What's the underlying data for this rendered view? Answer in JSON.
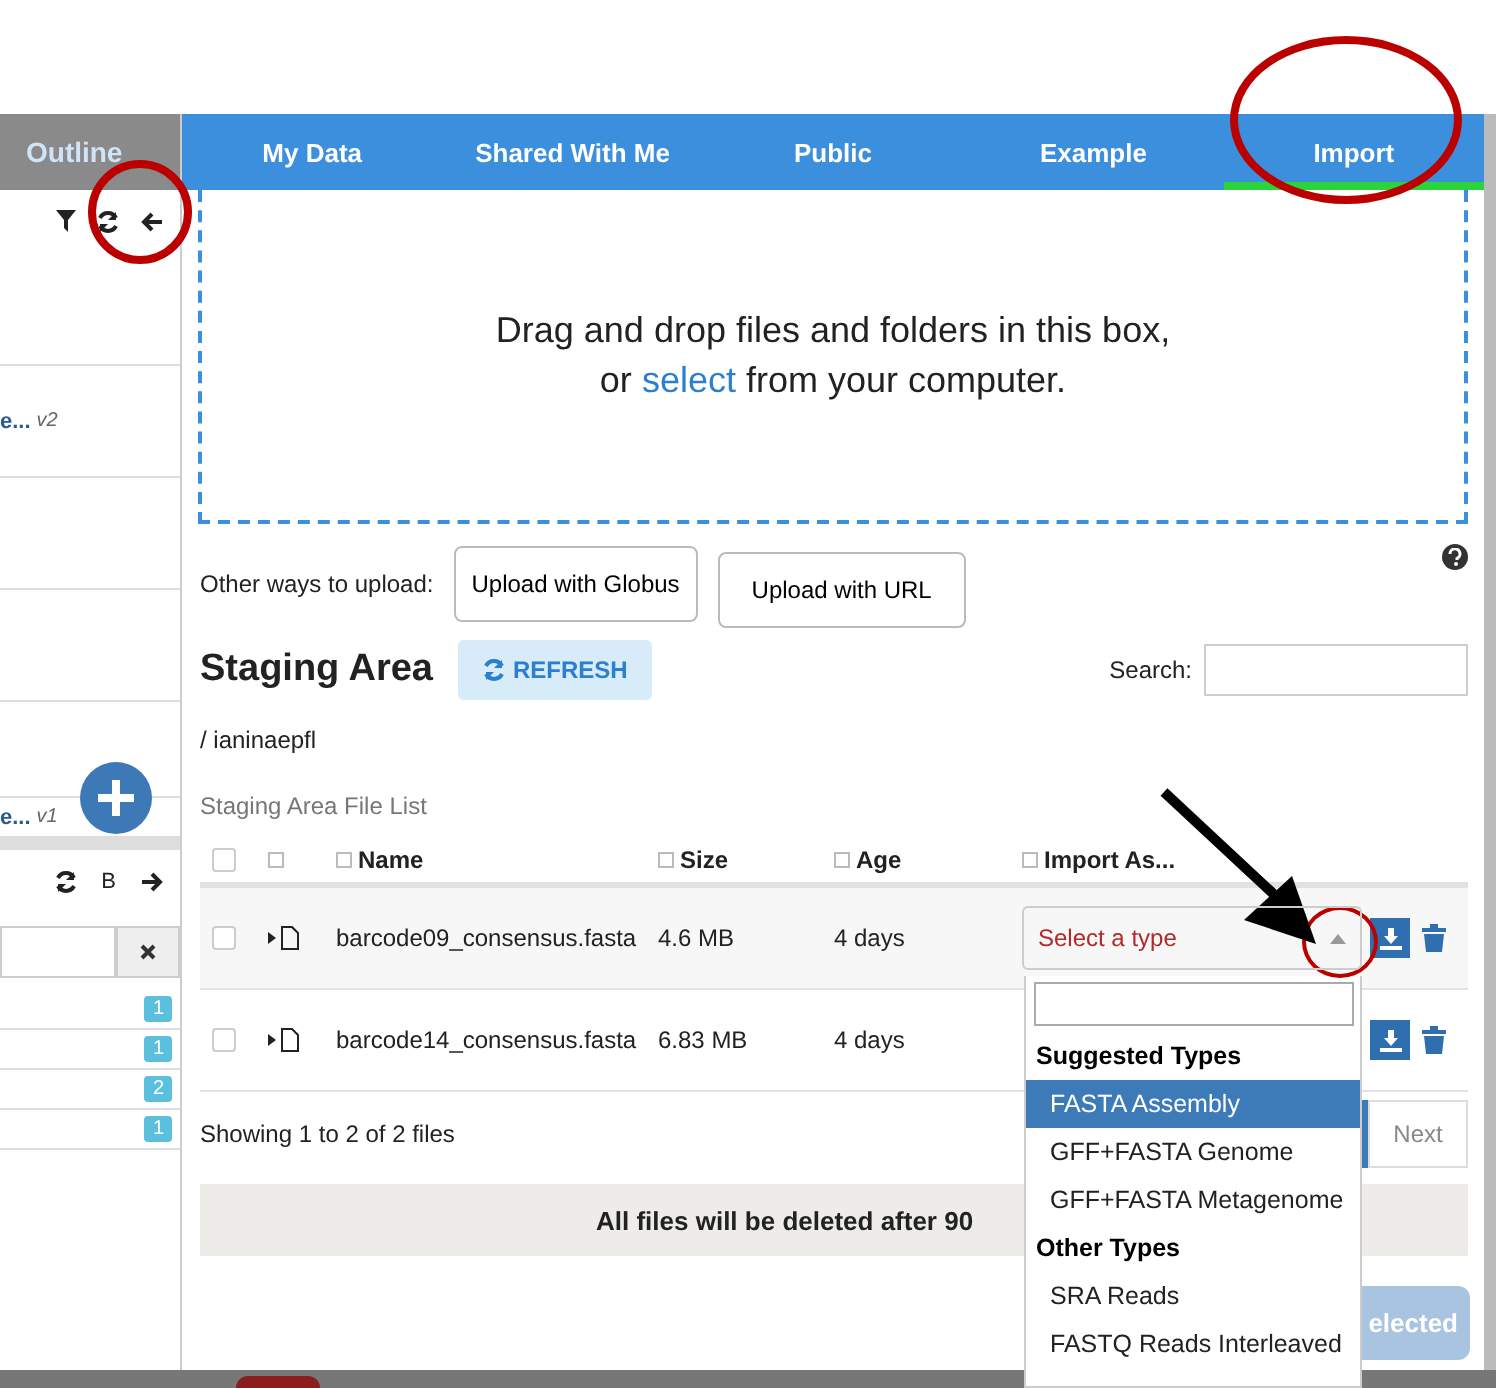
{
  "side_panel": {
    "title": "Outline",
    "items": [
      {
        "name": "e...",
        "version": "v2"
      },
      {
        "name": "e...",
        "version": "v1"
      }
    ],
    "toolbar_letter": "B",
    "counts": [
      "1",
      "1",
      "2",
      "1"
    ]
  },
  "tabs": [
    {
      "label": "My Data",
      "selected": false
    },
    {
      "label": "Shared With Me",
      "selected": false
    },
    {
      "label": "Public",
      "selected": false
    },
    {
      "label": "Example",
      "selected": false
    },
    {
      "label": "Import",
      "selected": true
    }
  ],
  "dropzone": {
    "before": "Drag and drop files and folders in this box,",
    "or": "or",
    "link": "select",
    "after": "from your computer."
  },
  "upload": {
    "label": "Other ways to upload:",
    "buttons": [
      "Upload with Globus",
      "Upload with URL"
    ]
  },
  "staging": {
    "title": "Staging Area",
    "refresh": "REFRESH",
    "search_label": "Search:",
    "path": "/ ianinaepfl",
    "list_title": "Staging Area File List"
  },
  "select_all": {
    "checked": false
  },
  "columns": [
    "Name",
    "Size",
    "Age",
    "Import As..."
  ],
  "files": [
    {
      "name": "barcode09_consensus.fasta",
      "size": "4.6 MB",
      "age": "4 days",
      "checked": false
    },
    {
      "name": "barcode14_consensus.fasta",
      "size": "6.83 MB",
      "age": "4 days",
      "checked": false
    }
  ],
  "select": {
    "placeholder": "Select a type",
    "groups": [
      {
        "title": "Suggested Types",
        "options": [
          {
            "label": "FASTA Assembly",
            "selected": true
          },
          {
            "label": "GFF+FASTA Genome",
            "selected": false
          },
          {
            "label": "GFF+FASTA Metagenome",
            "selected": false
          }
        ]
      },
      {
        "title": "Other Types",
        "options": [
          {
            "label": "SRA Reads",
            "selected": false
          },
          {
            "label": "FASTQ Reads Interleaved",
            "selected": false
          }
        ]
      }
    ]
  },
  "footer": {
    "showing": "Showing 1 to 2 of 2 files",
    "next": "Next",
    "notice": "All files will be deleted after 90",
    "import_button": "elected"
  }
}
